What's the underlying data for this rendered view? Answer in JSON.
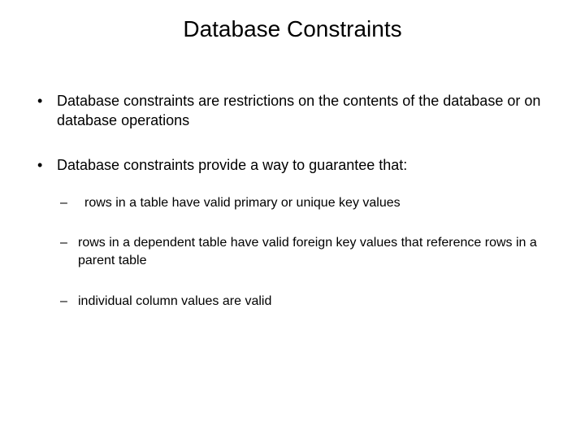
{
  "title": "Database Constraints",
  "bullets": [
    {
      "marker": "•",
      "text": "Database constraints are restrictions on the contents of the database or on database operations"
    },
    {
      "marker": "•",
      "text": "Database constraints provide a way to guarantee that:",
      "subs": [
        {
          "marker": "–",
          "text": "rows in a table have valid primary or unique key values"
        },
        {
          "marker": "–",
          "text": "rows in a dependent table have valid foreign key values that reference rows in a parent table"
        },
        {
          "marker": "–",
          "text": "individual column values are valid"
        }
      ]
    }
  ]
}
